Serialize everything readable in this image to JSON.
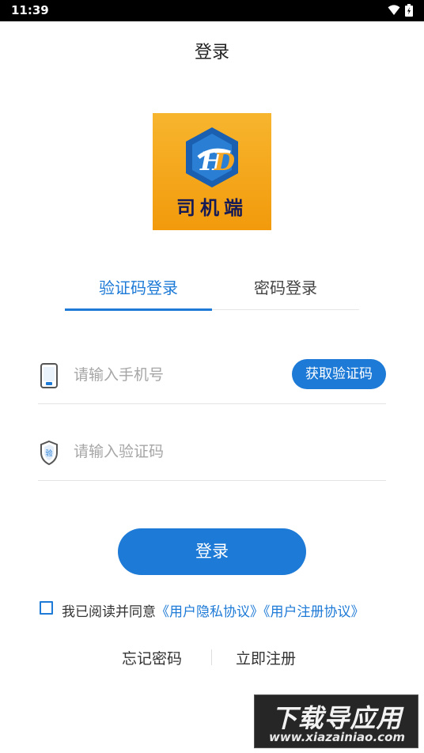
{
  "status_bar": {
    "time": "11:39"
  },
  "header": {
    "title": "登录"
  },
  "logo": {
    "text": "司机端"
  },
  "tabs": [
    {
      "label": "验证码登录",
      "active": true
    },
    {
      "label": "密码登录",
      "active": false
    }
  ],
  "phone": {
    "placeholder": "请输入手机号",
    "value": "",
    "get_code_label": "获取验证码"
  },
  "code": {
    "placeholder": "请输入验证码",
    "value": ""
  },
  "login_button": {
    "label": "登录"
  },
  "agreement": {
    "checked": false,
    "prefix": "我已阅读并同意",
    "privacy_link": "《用户隐私协议》",
    "register_link": "《用户注册协议》"
  },
  "footer": {
    "forgot_label": "忘记密码",
    "register_label": "立即注册"
  },
  "watermark": {
    "main": "下载导应用",
    "url": "www.xiazainiao.com"
  },
  "colors": {
    "accent": "#1d7ad6",
    "logo_bg": "#f29a0c",
    "logo_text": "#161a55"
  }
}
